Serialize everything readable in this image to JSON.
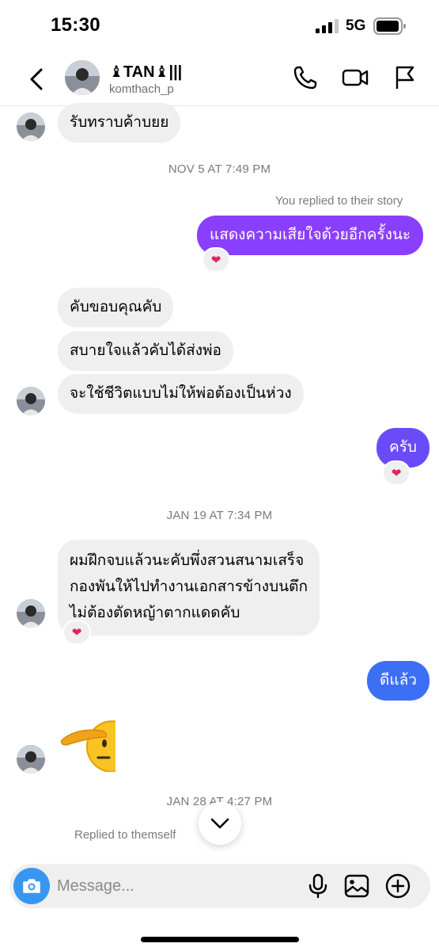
{
  "status_bar": {
    "time": "15:30",
    "network": "5G",
    "icons": [
      "signal-icon",
      "battery-icon"
    ]
  },
  "header": {
    "name": "♝TAN♝|||",
    "handle": "komthach_p",
    "icons": [
      "back-arrow-icon",
      "phone-icon",
      "video-camera-icon",
      "flag-icon"
    ]
  },
  "messages": [
    {
      "direction": "in",
      "text": "รับทราบค้าบยย"
    },
    {
      "type": "timestamp",
      "text": "NOV 5 AT 7:49 PM"
    },
    {
      "type": "note",
      "text": "You replied to their story"
    },
    {
      "direction": "out",
      "text": "แสดงความเสียใจด้วยอีกครั้งนะ",
      "reaction": "❤"
    },
    {
      "direction": "in",
      "text": "คับขอบคุณคับ"
    },
    {
      "direction": "in",
      "text": "สบายใจแล้วคับได้ส่งพ่อ"
    },
    {
      "direction": "in",
      "text": "จะใช้ชีวิตแบบไม่ให้พ่อต้องเป็นห่วง"
    },
    {
      "direction": "out",
      "text": "ครับ",
      "reaction": "❤"
    },
    {
      "type": "timestamp",
      "text": "JAN 19 AT 7:34 PM"
    },
    {
      "direction": "in",
      "lines": [
        "ผมฝึกจบแล้วนะคับพึ่งสวนสนามเสร็จ",
        "กองพันให้ไปทำงานเอกสารข้างบนตึก",
        "ไม่ต้องตัดหญ้าตากแดดคับ"
      ],
      "reaction": "❤"
    },
    {
      "direction": "out",
      "text": "ดีแล้ว"
    },
    {
      "direction": "in",
      "emoji": "saluting-face"
    },
    {
      "type": "timestamp",
      "text": "JAN 28 AT 4:27 PM"
    },
    {
      "type": "note",
      "text": "Replied to themself"
    }
  ],
  "composer": {
    "placeholder": "Message...",
    "icons": [
      "camera-icon",
      "microphone-icon",
      "image-icon",
      "plus-circle-icon"
    ]
  },
  "colors": {
    "bubble_out_top": "#8a3ffc",
    "bubble_out_mid": "#6a4bfa",
    "bubble_out_bottom": "#3d6ff5",
    "bubble_in": "#efefef",
    "camera_button": "#3797f0",
    "heart": "#e0245e"
  }
}
